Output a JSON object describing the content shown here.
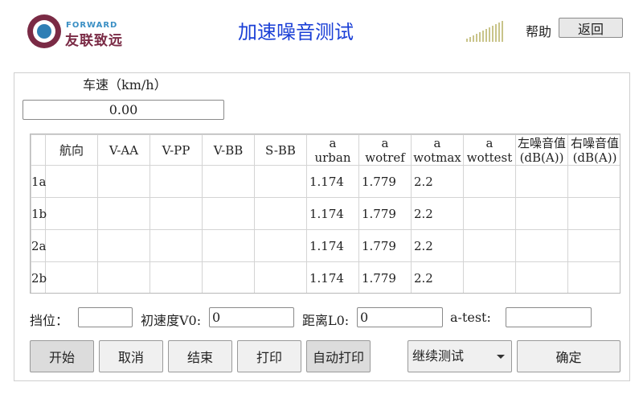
{
  "header": {
    "logo_en": "FORWARD",
    "logo_cn": "友联致远",
    "title": "加速噪音测试",
    "help_label": "帮助",
    "back_label": "返回"
  },
  "speed": {
    "label": "车速（km/h）",
    "value": "0.00"
  },
  "table": {
    "columns": [
      "航向",
      "V-AA",
      "V-PP",
      "V-BB",
      "S-BB",
      "a\nurban",
      "a\nwotref",
      "a\nwotmax",
      "a\nwottest",
      "左噪音值\n(dB(A))",
      "右噪音值\n(dB(A))"
    ],
    "rows": [
      {
        "head": "1a",
        "cells": [
          "",
          "",
          "",
          "",
          "",
          "1.174",
          "1.779",
          "2.2",
          "",
          "",
          ""
        ]
      },
      {
        "head": "1b",
        "cells": [
          "",
          "",
          "",
          "",
          "",
          "1.174",
          "1.779",
          "2.2",
          "",
          "",
          ""
        ]
      },
      {
        "head": "2a",
        "cells": [
          "",
          "",
          "",
          "",
          "",
          "1.174",
          "1.779",
          "2.2",
          "",
          "",
          ""
        ]
      },
      {
        "head": "2b",
        "cells": [
          "",
          "",
          "",
          "",
          "",
          "1.174",
          "1.779",
          "2.2",
          "",
          "",
          ""
        ]
      }
    ]
  },
  "params": {
    "gear_label": "挡位：",
    "gear_value": "",
    "v0_label": "初速度V0:",
    "v0_value": "0",
    "l0_label": "距离L0:",
    "l0_value": "0",
    "atest_label": "a-test:",
    "atest_value": ""
  },
  "buttons": {
    "start": "开始",
    "cancel": "取消",
    "end": "结束",
    "print": "打印",
    "auto_print": "自动打印",
    "mode_selected": "继续测试",
    "confirm": "确定"
  }
}
